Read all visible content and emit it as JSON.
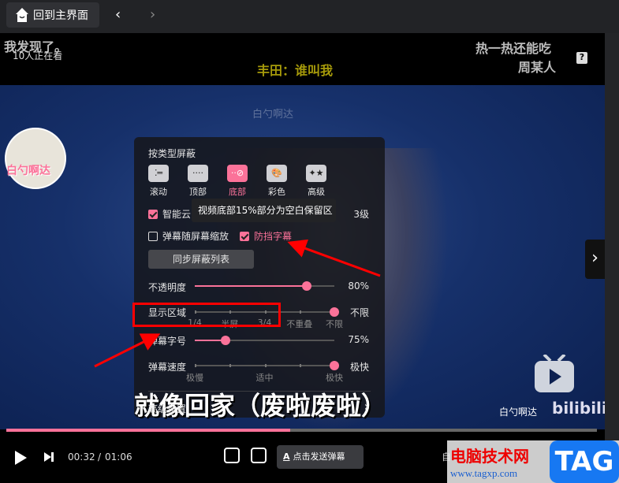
{
  "topbar": {
    "home_label": "回到主界面",
    "back": "‹",
    "forward": "›"
  },
  "video": {
    "danmaku": [
      "我发现了。",
      "热一热还能吃",
      "周某人",
      "丰田：谁叫我"
    ],
    "viewers": "10人正在看",
    "subtitle": "就像回家（废啦废啦）",
    "uploader": "白勺啊达",
    "avatar_text": "白勺啊达",
    "brand": "bilibili",
    "help": "?",
    "next": "›"
  },
  "panel": {
    "title": "按类型屏蔽",
    "types": [
      {
        "label": "滚动",
        "active": false
      },
      {
        "label": "顶部",
        "active": false
      },
      {
        "label": "底部",
        "active": true
      },
      {
        "label": "彩色",
        "active": false
      },
      {
        "label": "高级",
        "active": false
      }
    ],
    "smart_cloud": {
      "label": "智能云",
      "checked": true,
      "level": "3级"
    },
    "tooltip": "视频底部15%部分为空白保留区",
    "scale_with_screen": {
      "label": "弹幕随屏幕缩放",
      "checked": false
    },
    "prevent_subtitle": {
      "label": "防挡字幕",
      "checked": true
    },
    "sync_button": "同步屏蔽列表",
    "opacity": {
      "label": "不透明度",
      "value": "80%",
      "percent": 80
    },
    "display_area": {
      "label": "显示区域",
      "value": "不限",
      "ticks": [
        "1/4",
        "半屏",
        "3/4",
        "不重叠",
        "不限"
      ],
      "selected_index": 4
    },
    "font_size": {
      "label": "弹幕字号",
      "value": "75%",
      "percent": 22
    },
    "speed": {
      "label": "弹幕速度",
      "value": "极快",
      "ticks": [
        "极慢",
        "适中",
        "极快"
      ],
      "selected_index": 4
    },
    "advanced": "高级设置",
    "advanced_arrow": "›"
  },
  "controls": {
    "current": "00:32",
    "sep": "/",
    "total": "01:06",
    "progress_percent": 48,
    "send_placeholder": "点击发送弹幕",
    "send_icon": "A",
    "extra": "自"
  },
  "watermark": {
    "site": "电脑技术网",
    "url": "www.tagxp.com",
    "tag": "TAG"
  },
  "colors": {
    "accent": "#fb7299",
    "annotation": "#ff0000"
  }
}
